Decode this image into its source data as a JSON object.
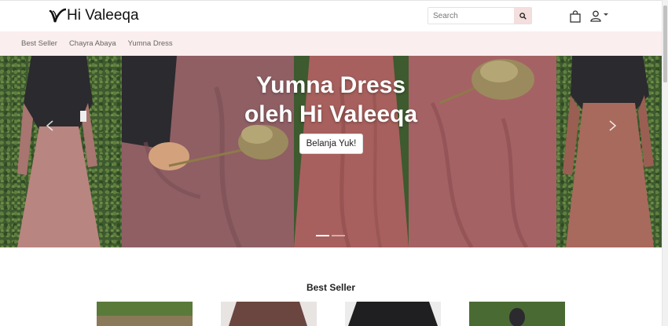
{
  "header": {
    "brand": "Hi Valeeqa",
    "search_placeholder": "Search",
    "icons": [
      "search-icon",
      "shopping-bag-icon",
      "user-icon",
      "caret-down-icon"
    ]
  },
  "subnav": {
    "items": [
      "Best Seller",
      "Chayra Abaya",
      "Yumna Dress"
    ]
  },
  "hero": {
    "title_line1": "Yumna Dress",
    "title_line2": "oleh Hi Valeeqa",
    "cta": "Belanja Yuk!",
    "active_slide": 1,
    "slide_count": 2
  },
  "section": {
    "title": "Best Seller"
  },
  "colors": {
    "brand_accent": "#f4dede",
    "subnav_bg": "#fbeeee",
    "dress_rose": "#b98580",
    "dress_terracotta": "#a25e5b",
    "dress_mauve": "#8d5d62",
    "khimar_black": "#2b2a2e",
    "hedge_green": "#3e5a2f"
  }
}
